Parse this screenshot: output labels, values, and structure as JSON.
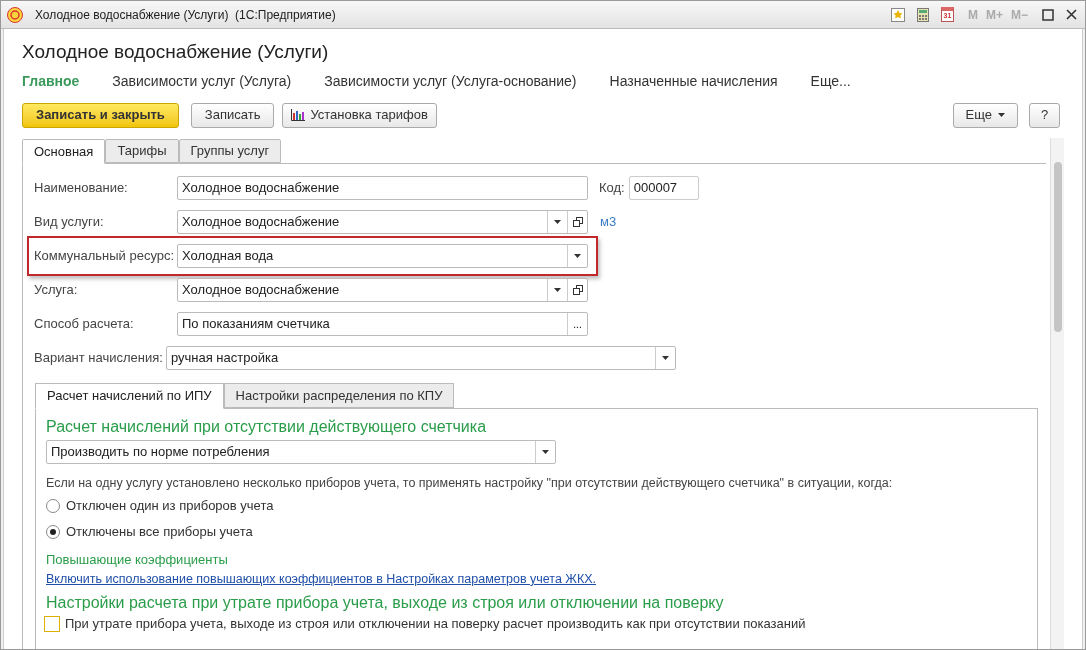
{
  "window": {
    "title": "Холодное водоснабжение (Услуги)  (1С:Предприятие)",
    "memory_buttons": [
      "M",
      "M+",
      "M−"
    ],
    "calendar_label": "31"
  },
  "form": {
    "title": "Холодное водоснабжение (Услуги)"
  },
  "nav": [
    {
      "label": "Главное",
      "selected": true
    },
    {
      "label": "Зависимости услуг (Услуга)",
      "selected": false
    },
    {
      "label": "Зависимости услуг (Услуга-основание)",
      "selected": false
    },
    {
      "label": "Назначенные начисления",
      "selected": false
    },
    {
      "label": "Еще...",
      "selected": false
    }
  ],
  "commands": [
    {
      "label": "Записать и закрыть",
      "kind": "primary"
    },
    {
      "label": "Записать",
      "kind": "plain"
    },
    {
      "label": "Установка тарифов",
      "kind": "chart"
    }
  ],
  "right_commands": [
    {
      "label": "Еще",
      "kind": "menu"
    },
    {
      "label": "?",
      "kind": "plain"
    }
  ],
  "tabs": [
    {
      "label": "Основная",
      "selected": true
    },
    {
      "label": "Тарифы",
      "selected": false
    },
    {
      "label": "Группы услуг",
      "selected": false
    }
  ],
  "fields": [
    {
      "label": "Наименование:",
      "value": "Холодное водоснабжение",
      "kind": "input",
      "highlighted": false,
      "code": {
        "label": "Код:",
        "value": "000007"
      }
    },
    {
      "label": "Вид услуги:",
      "value": "Холодное водоснабжение",
      "kind": "dropdown_open",
      "highlighted": false,
      "unit": "м3"
    },
    {
      "label": "Коммунальный ресурс:",
      "value": "Холодная вода",
      "kind": "dropdown",
      "highlighted": true
    },
    {
      "label": "Услуга:",
      "value": "Холодное водоснабжение",
      "kind": "dropdown_open",
      "highlighted": false
    },
    {
      "label": "Способ расчета:",
      "value": "По показаниям счетчика",
      "kind": "choice",
      "highlighted": false,
      "button_label": "..."
    }
  ],
  "variant": {
    "label": "Вариант начисления:",
    "value": "ручная настройка"
  },
  "sub_tabs": [
    {
      "label": "Расчет начислений по ИПУ",
      "selected": true
    },
    {
      "label": "Настройки распределения по КПУ",
      "selected": false
    }
  ],
  "section1": {
    "heading": "Расчет начислений при отсутствии действующего счетчика",
    "dropdown": "Производить по норме потребления",
    "note": "Если на одну услугу установлено несколько приборов учета, то применять настройку \"при отсутствии действующего счетчика\" в ситуации, когда:",
    "options": [
      {
        "label": "Отключен один из приборов учета",
        "selected": false
      },
      {
        "label": "Отключены все приборы учета",
        "selected": true
      }
    ],
    "subheading": "Повышающие коэффициенты",
    "link": "Включить использование повышающих коэффициентов в Настройках параметров учета ЖКХ."
  },
  "section2": {
    "heading": "Настройки расчета при утрате прибора учета, выходе из строя или отключении на поверку",
    "checkbox": {
      "label": "При утрате прибора учета, выходе из строя или отключении на поверку расчет производить как при отсутствии показаний",
      "checked": false
    }
  }
}
